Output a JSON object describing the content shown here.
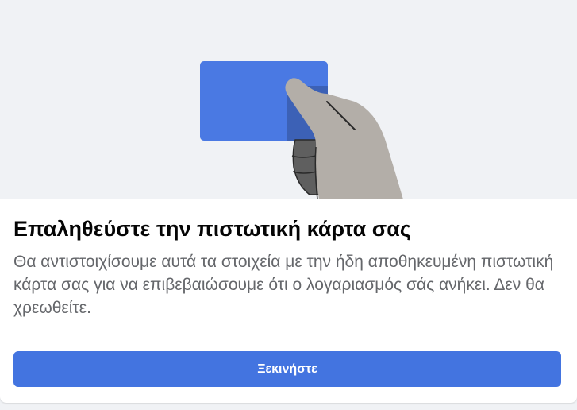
{
  "dialog": {
    "title": "Επαληθεύστε την πιστωτική κάρτα σας",
    "description": "Θα αντιστοιχίσουμε αυτά τα στοιχεία με την ήδη αποθηκευμένη πιστωτική κάρτα σας για να επιβεβαιώσουμε ότι ο λογαριασμός σάς ανήκει. Δεν θα χρεωθείτε.",
    "primary_button_label": "Ξεκινήστε"
  },
  "illustration": {
    "icon": "hand-holding-credit-card-illustration",
    "card_color": "#4a79e3",
    "hand_color": "#b3aea8"
  },
  "colors": {
    "accent": "#4374e0",
    "hero_background": "#f0f2f5"
  }
}
